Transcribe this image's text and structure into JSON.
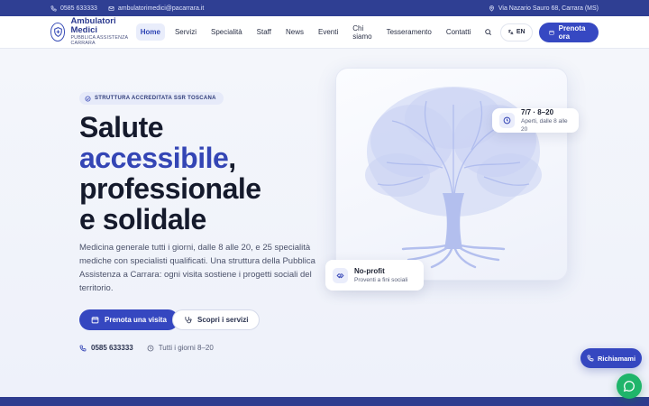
{
  "topbar": {
    "phone": "0585 633333",
    "email": "ambulatorimedici@pacarrara.it",
    "address": "Via Nazario Sauro 68, Carrara (MS)"
  },
  "brand": {
    "name": "Ambulatori Medici",
    "tagline": "PUBBLICA ASSISTENZA CARRARA"
  },
  "nav": {
    "items": [
      {
        "label": "Home",
        "active": true
      },
      {
        "label": "Servizi",
        "active": false
      },
      {
        "label": "Specialità",
        "active": false
      },
      {
        "label": "Staff",
        "active": false
      },
      {
        "label": "News",
        "active": false
      },
      {
        "label": "Eventi",
        "active": false
      },
      {
        "label": "Chi siamo",
        "active": false
      },
      {
        "label": "Tesseramento",
        "active": false
      },
      {
        "label": "Contatti",
        "active": false
      }
    ],
    "language": "EN",
    "book_label": "Prenota ora"
  },
  "hero": {
    "badge": "STRUTTURA ACCREDITATA SSR TOSCANA",
    "headline_line1": "Salute",
    "headline_accent": "accessibile",
    "headline_comma": ",",
    "headline_line3": "professionale",
    "headline_line4": "e solidale",
    "lead": "Medicina generale tutti i giorni, dalle 8 alle 20, e 25 specialità mediche con specialisti qualificati. Una struttura della Pubblica Assistenza a Carrara: ogni visita sostiene i progetti sociali del territorio.",
    "cta_primary": "Prenota una visita",
    "cta_secondary": "Scopri i servizi",
    "contact_phone": "0585 633333",
    "contact_hours": "Tutti i giorni 8–20"
  },
  "cards": {
    "hours_title": "7/7 · 8–20",
    "hours_sub": "Aperti, dalle 8 alle 20",
    "nonprofit_title": "No-profit",
    "nonprofit_sub": "Proventi a fini sociali"
  },
  "floating": {
    "callback_label": "Richiamami"
  },
  "colors": {
    "primary": "#3547c0",
    "topbar": "#2f3f93",
    "accent_text": "#3445b5",
    "tree": "#c9d2f3",
    "chat": "#1fb56a"
  }
}
